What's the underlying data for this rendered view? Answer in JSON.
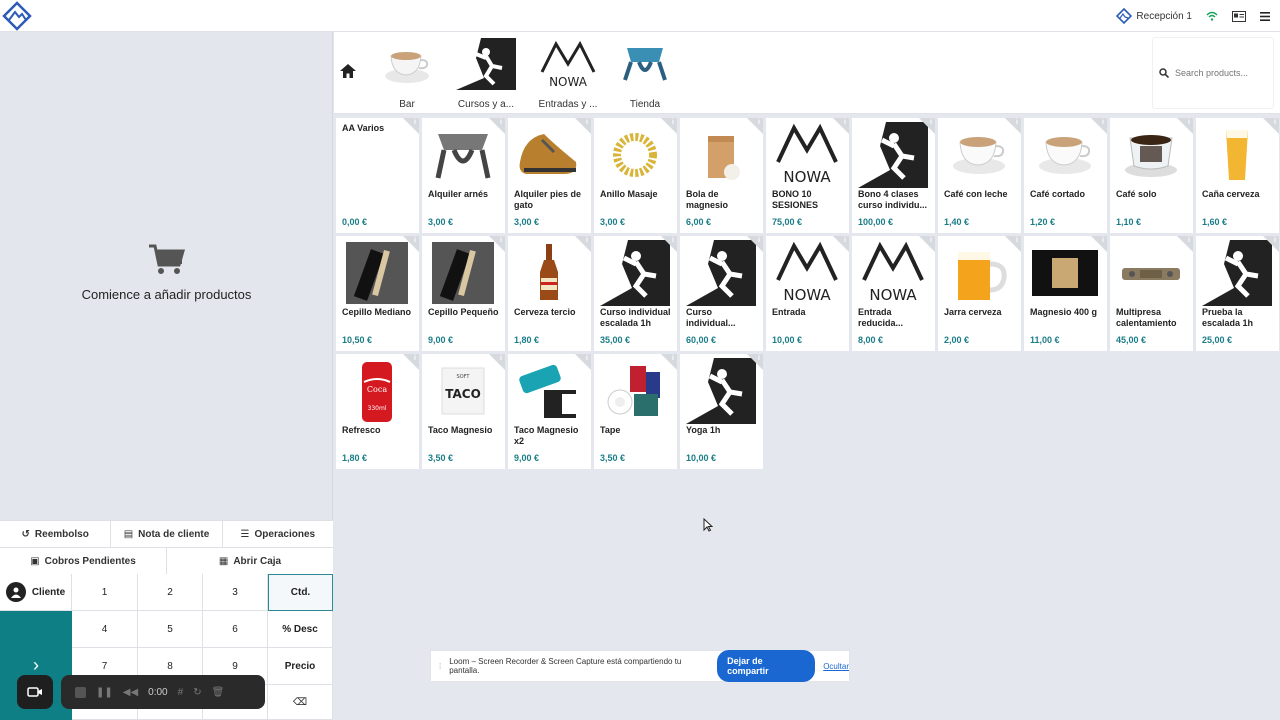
{
  "topbar": {
    "register": "Recepción 1"
  },
  "cart": {
    "empty_message": "Comience a añadir productos"
  },
  "actions": {
    "refund": "Reembolso",
    "customer_note": "Nota de cliente",
    "operations": "Operaciones",
    "pending": "Cobros Pendientes",
    "open_cash": "Abrir Caja"
  },
  "numpad": {
    "customer": "Cliente",
    "keys": [
      "1",
      "2",
      "3",
      "4",
      "5",
      "6",
      "7",
      "8",
      "9"
    ],
    "qty": "Ctd.",
    "disc": "% Desc",
    "price": "Precio",
    "backspace": "⌫"
  },
  "recorder": {
    "time": "0:00"
  },
  "categories": [
    "Bar",
    "Cursos y a...",
    "Entradas y ...",
    "Tienda"
  ],
  "search": {
    "placeholder": "Search products..."
  },
  "products": [
    {
      "name": "AA Varios",
      "price": "0,00 €",
      "img": "none"
    },
    {
      "name": "Alquiler arnés",
      "price": "3,00 €",
      "img": "harness"
    },
    {
      "name": "Alquiler pies de gato",
      "price": "3,00 €",
      "img": "shoe"
    },
    {
      "name": "Anillo Masaje",
      "price": "3,00 €",
      "img": "ring"
    },
    {
      "name": "Bola de magnesio",
      "price": "6,00 €",
      "img": "bag"
    },
    {
      "name": "BONO 10 SESIONES",
      "price": "75,00 €",
      "img": "nowa"
    },
    {
      "name": "Bono 4 clases curso individu...",
      "price": "100,00 €",
      "img": "climber"
    },
    {
      "name": "Café con leche",
      "price": "1,40 €",
      "img": "coffee"
    },
    {
      "name": "Café cortado",
      "price": "1,20 €",
      "img": "coffee"
    },
    {
      "name": "Café solo",
      "price": "1,10 €",
      "img": "espresso"
    },
    {
      "name": "Caña cerveza",
      "price": "1,60 €",
      "img": "beer"
    },
    {
      "name": "Cepillo Mediano",
      "price": "10,50 €",
      "img": "brush"
    },
    {
      "name": "Cepillo Pequeño",
      "price": "9,00 €",
      "img": "brush"
    },
    {
      "name": "Cerveza tercio",
      "price": "1,80 €",
      "img": "bottle"
    },
    {
      "name": "Curso individual escalada 1h",
      "price": "35,00 €",
      "img": "climber"
    },
    {
      "name": "Curso individual...",
      "price": "60,00 €",
      "img": "climber"
    },
    {
      "name": "Entrada",
      "price": "10,00 €",
      "img": "nowa"
    },
    {
      "name": "Entrada reducida...",
      "price": "8,00 €",
      "img": "nowa"
    },
    {
      "name": "Jarra cerveza",
      "price": "2,00 €",
      "img": "mug"
    },
    {
      "name": "Magnesio 400 g",
      "price": "11,00 €",
      "img": "chalk"
    },
    {
      "name": "Multipresa calentamiento",
      "price": "45,00 €",
      "img": "board"
    },
    {
      "name": "Prueba la escalada 1h",
      "price": "25,00 €",
      "img": "climber"
    },
    {
      "name": "Refresco",
      "price": "1,80 €",
      "img": "can"
    },
    {
      "name": "Taco Magnesio",
      "price": "3,50 €",
      "img": "taco"
    },
    {
      "name": "Taco Magnesio x2",
      "price": "9,00 €",
      "img": "taco2"
    },
    {
      "name": "Tape",
      "price": "3,50 €",
      "img": "tape"
    },
    {
      "name": "Yoga 1h",
      "price": "10,00 €",
      "img": "climber"
    }
  ],
  "share_banner": {
    "text": "Loom – Screen Recorder & Screen Capture está compartiendo tu pantalla.",
    "stop": "Dejar de compartir",
    "hide": "Ocultar"
  }
}
